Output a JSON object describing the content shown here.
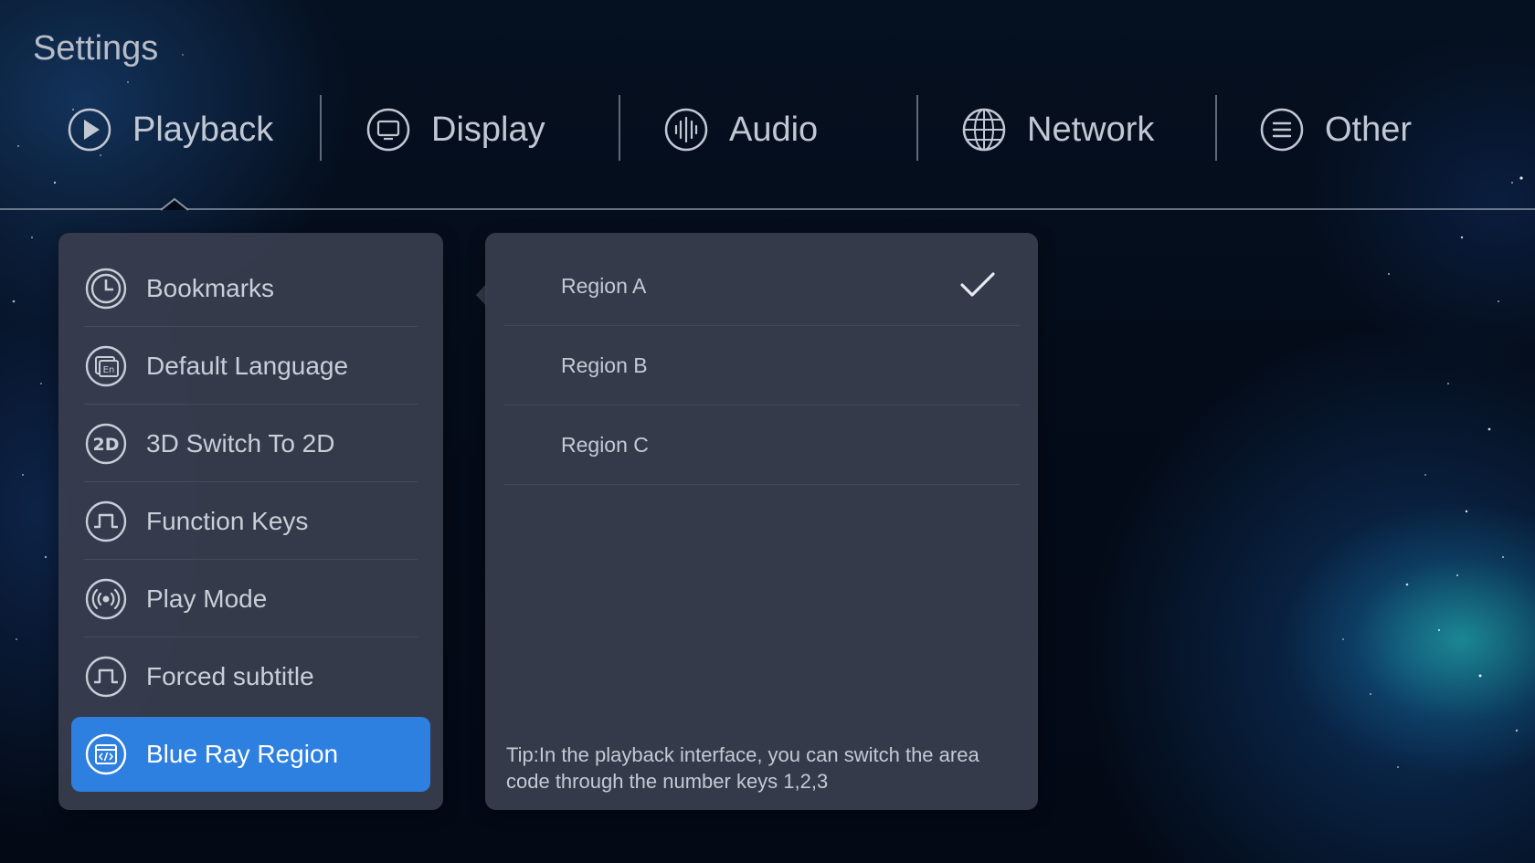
{
  "header": {
    "title": "Settings"
  },
  "tabs": [
    {
      "id": "playback",
      "label": "Playback",
      "icon": "play-circle-icon",
      "selected": true
    },
    {
      "id": "display",
      "label": "Display",
      "icon": "monitor-icon"
    },
    {
      "id": "audio",
      "label": "Audio",
      "icon": "audio-wave-icon"
    },
    {
      "id": "network",
      "label": "Network",
      "icon": "globe-icon"
    },
    {
      "id": "other",
      "label": "Other",
      "icon": "list-menu-icon"
    }
  ],
  "playback_menu": {
    "items": [
      {
        "id": "bookmarks",
        "label": "Bookmarks",
        "icon": "clock-icon"
      },
      {
        "id": "default-language",
        "label": "Default Language",
        "icon": "language-en-icon"
      },
      {
        "id": "3d-switch",
        "label": "3D Switch To 2D",
        "icon": "2d-icon"
      },
      {
        "id": "function-keys",
        "label": "Function Keys",
        "icon": "pulse-wave-icon"
      },
      {
        "id": "play-mode",
        "label": "Play Mode",
        "icon": "broadcast-icon"
      },
      {
        "id": "forced-subtitle",
        "label": "Forced subtitle",
        "icon": "pulse-wave-icon"
      },
      {
        "id": "blue-ray-region",
        "label": "Blue Ray Region",
        "icon": "code-window-icon",
        "selected": true
      }
    ]
  },
  "region_options": {
    "items": [
      {
        "id": "region-a",
        "label": "Region A",
        "checked": true
      },
      {
        "id": "region-b",
        "label": "Region B"
      },
      {
        "id": "region-c",
        "label": "Region C"
      }
    ],
    "tip": "Tip:In the playback interface, you can switch the area code through the number keys 1,2,3"
  },
  "colors": {
    "accent": "#2d7fe0",
    "panel": "#383e4f",
    "background": "#040b18",
    "text": "#c9ced8"
  }
}
